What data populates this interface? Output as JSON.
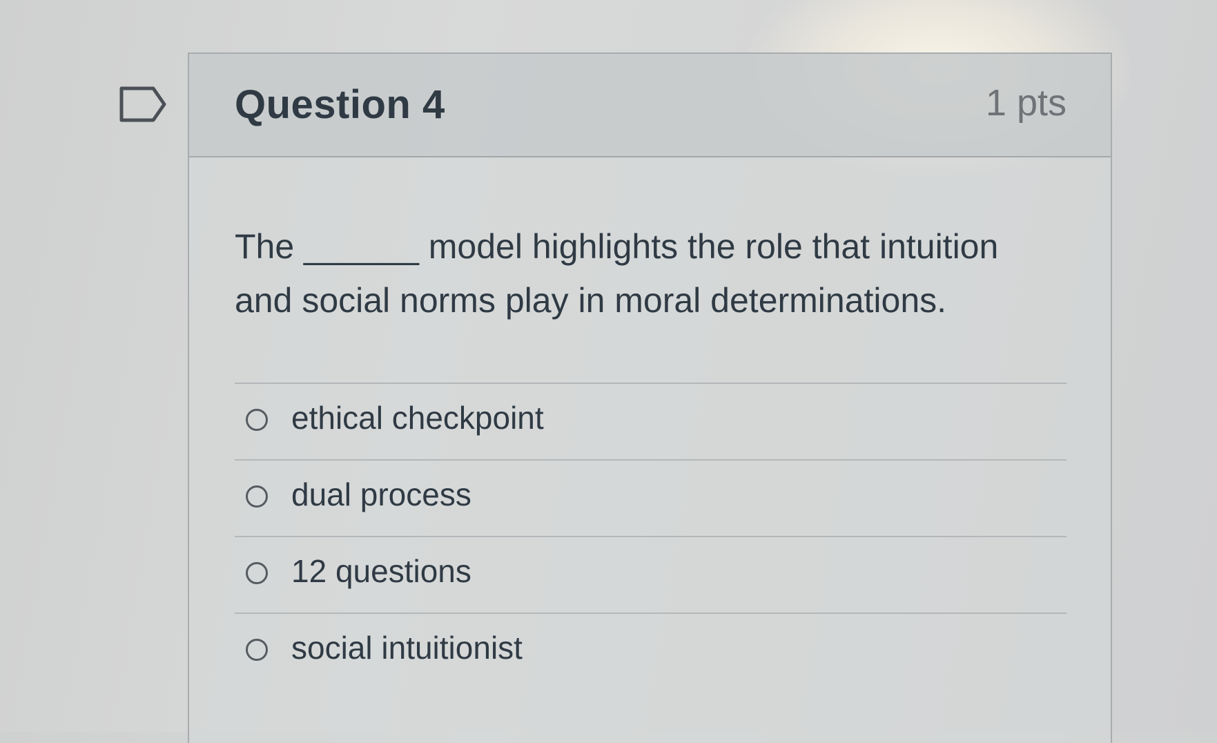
{
  "question": {
    "title": "Question 4",
    "points": "1 pts",
    "text": "The ______ model highlights the role that intuition and social norms play in moral determinations."
  },
  "answers": [
    {
      "label": "ethical checkpoint",
      "selected": false
    },
    {
      "label": "dual process",
      "selected": false
    },
    {
      "label": "12 questions",
      "selected": false
    },
    {
      "label": "social intuitionist",
      "selected": false
    }
  ],
  "icons": {
    "flag": "flag-question-icon",
    "radio": "radio-unchecked-icon"
  }
}
